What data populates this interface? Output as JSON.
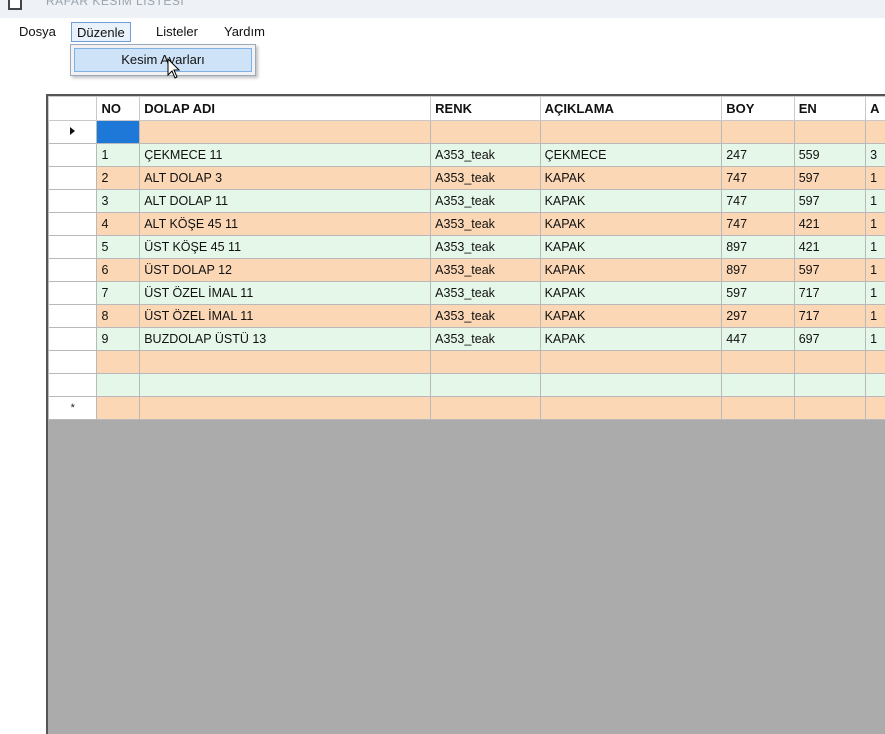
{
  "window": {
    "title": "RAFAR KESİM LİSTESİ"
  },
  "menubar": {
    "items": [
      {
        "label": "Dosya"
      },
      {
        "label": "Düzenle"
      },
      {
        "label": "Listeler"
      },
      {
        "label": "Yardım"
      }
    ],
    "open_menu_item": "Kesim Ayarları"
  },
  "grid": {
    "columns": [
      "NO",
      "DOLAP ADI",
      "RENK",
      "AÇIKLAMA",
      "BOY",
      "EN",
      "A"
    ],
    "rows": [
      [
        "",
        "",
        "",
        "",
        "",
        "",
        ""
      ],
      [
        "1",
        "ÇEKMECE 11",
        "A353_teak",
        "ÇEKMECE",
        "247",
        "559",
        "3"
      ],
      [
        "2",
        "ALT DOLAP 3",
        "A353_teak",
        "KAPAK",
        "747",
        "597",
        "1"
      ],
      [
        "3",
        "ALT DOLAP 11",
        "A353_teak",
        "KAPAK",
        "747",
        "597",
        "1"
      ],
      [
        "4",
        "ALT KÖŞE 45 11",
        "A353_teak",
        "KAPAK",
        "747",
        "421",
        "1"
      ],
      [
        "5",
        "ÜST KÖŞE 45 11",
        "A353_teak",
        "KAPAK",
        "897",
        "421",
        "1"
      ],
      [
        "6",
        "ÜST DOLAP 12",
        "A353_teak",
        "KAPAK",
        "897",
        "597",
        "1"
      ],
      [
        "7",
        "ÜST ÖZEL İMAL 11",
        "A353_teak",
        "KAPAK",
        "597",
        "717",
        "1"
      ],
      [
        "8",
        "ÜST ÖZEL İMAL 11",
        "A353_teak",
        "KAPAK",
        "297",
        "717",
        "1"
      ],
      [
        "9",
        "BUZDOLAP ÜSTÜ 13",
        "A353_teak",
        "KAPAK",
        "447",
        "697",
        "1"
      ],
      [
        "",
        "",
        "",
        "",
        "",
        "",
        ""
      ],
      [
        "",
        "",
        "",
        "",
        "",
        "",
        ""
      ],
      [
        "",
        "",
        "",
        "",
        "",
        "",
        ""
      ]
    ],
    "new_row_marker": "*",
    "colors": {
      "row_peach": "#fbd7b5",
      "row_mint": "#e5f7e9",
      "selected_cell": "#1e78d8",
      "empty_area": "#ababab"
    }
  }
}
